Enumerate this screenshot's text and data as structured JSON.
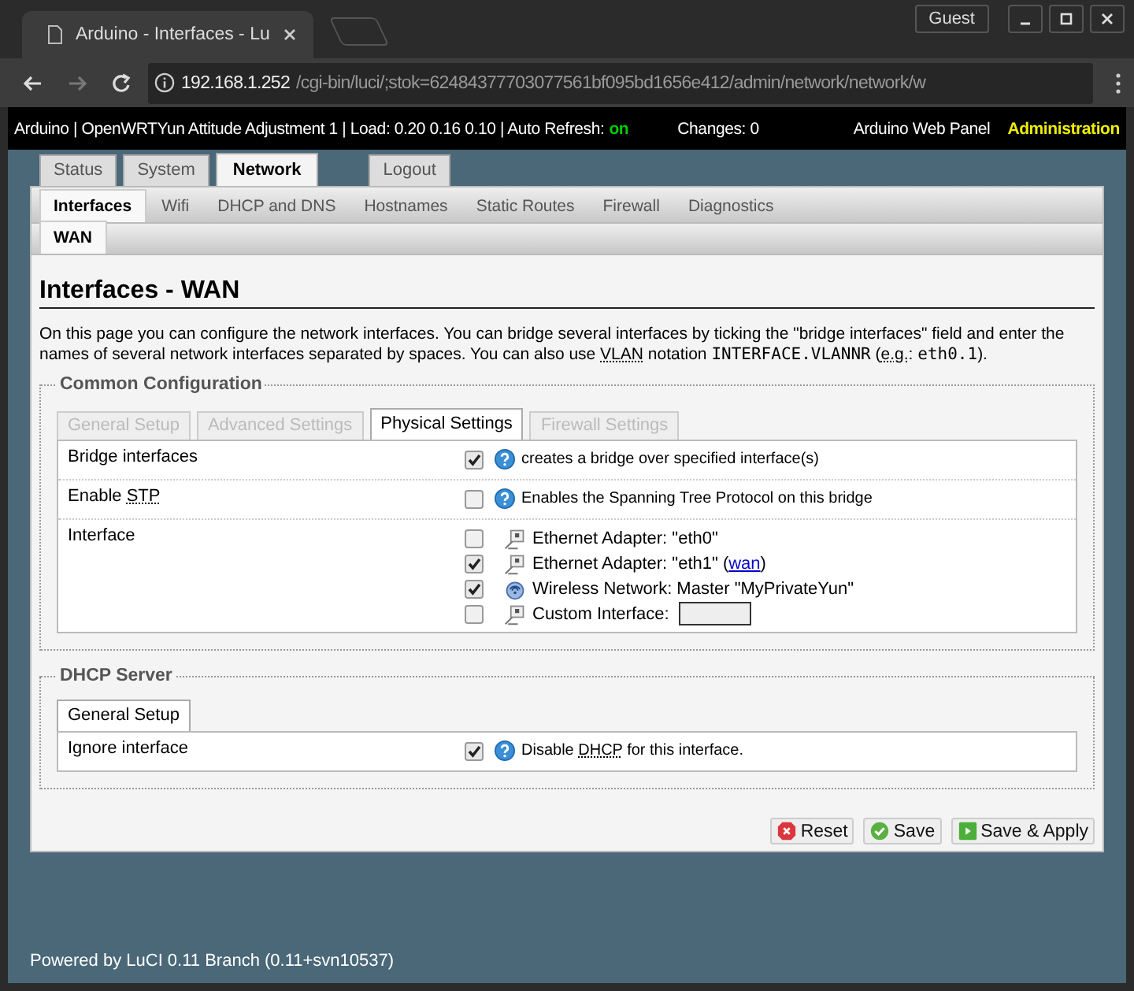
{
  "browser": {
    "tab_title": "Arduino - Interfaces - Lu",
    "user": "Guest",
    "url_host": "192.168.1.252",
    "url_path": "/cgi-bin/luci/;stok=62484377703077561bf095bd1656e412/admin/network/network/w"
  },
  "header": {
    "text": "Arduino | OpenWRTYun Attitude Adjustment 1 | Load: 0.20 0.16 0.10 | Auto Refresh:",
    "refresh": "on",
    "changes": "Changes: 0",
    "panel_link": "Arduino Web Panel",
    "admin_link": "Administration"
  },
  "main_tabs": [
    {
      "label": "Status",
      "selected": false
    },
    {
      "label": "System",
      "selected": false
    },
    {
      "label": "Network",
      "selected": true
    }
  ],
  "logout": "Logout",
  "sub_tabs": [
    {
      "label": "Interfaces",
      "selected": true
    },
    {
      "label": "Wifi",
      "selected": false
    },
    {
      "label": "DHCP and DNS",
      "selected": false
    },
    {
      "label": "Hostnames",
      "selected": false
    },
    {
      "label": "Static Routes",
      "selected": false
    },
    {
      "label": "Firewall",
      "selected": false
    },
    {
      "label": "Diagnostics",
      "selected": false
    }
  ],
  "interface_tabs": [
    {
      "label": "WAN",
      "selected": true
    }
  ],
  "title": "Interfaces - WAN",
  "description": [
    {
      "kind": "text",
      "text": "On this page you can configure the network interfaces. You can bridge several interfaces by ticking the \"bridge interfaces\" field and enter the names of several network interfaces separated by spaces. You can also use "
    },
    {
      "kind": "abbr",
      "text": "VLAN"
    },
    {
      "kind": "text",
      "text": " notation "
    },
    {
      "kind": "code",
      "text": "INTERFACE.VLANNR"
    },
    {
      "kind": "text",
      "text": " ("
    },
    {
      "kind": "abbr",
      "text": "e.g."
    },
    {
      "kind": "text",
      "text": ": "
    },
    {
      "kind": "code",
      "text": "eth0.1"
    },
    {
      "kind": "text",
      "text": ")."
    }
  ],
  "sections": [
    {
      "title": "Common Configuration",
      "tabs": [
        {
          "label": "General Setup",
          "selected": false
        },
        {
          "label": "Advanced Settings",
          "selected": false
        },
        {
          "label": "Physical Settings",
          "selected": true
        },
        {
          "label": "Firewall Settings",
          "selected": false
        }
      ],
      "rows": [
        {
          "kind": "flag",
          "label": [
            {
              "kind": "text",
              "text": "Bridge interfaces"
            }
          ],
          "checked": true,
          "help": [
            {
              "kind": "text",
              "text": "creates a bridge over specified interface(s)"
            }
          ]
        },
        {
          "kind": "flag",
          "label": [
            {
              "kind": "text",
              "text": "Enable "
            },
            {
              "kind": "abbr",
              "text": "STP"
            }
          ],
          "checked": false,
          "help": [
            {
              "kind": "text",
              "text": "Enables the Spanning Tree Protocol on this bridge"
            }
          ]
        },
        {
          "kind": "interfaces",
          "label": [
            {
              "kind": "text",
              "text": "Interface"
            }
          ],
          "options": [
            {
              "checked": false,
              "kind": "ethernet",
              "text": "Ethernet Adapter: \"eth0\""
            },
            {
              "checked": true,
              "kind": "ethernet",
              "text": "Ethernet Adapter: \"eth1\" (",
              "link": "wan",
              "after": ")"
            },
            {
              "checked": true,
              "kind": "wireless",
              "text": "Wireless Network: Master \"MyPrivateYun\""
            },
            {
              "checked": false,
              "kind": "custom",
              "text": "Custom Interface:"
            }
          ]
        }
      ]
    },
    {
      "title": "DHCP Server",
      "tabs": [
        {
          "label": "General Setup",
          "selected": true
        }
      ],
      "rows": [
        {
          "kind": "flag",
          "label": [
            {
              "kind": "text",
              "text": "Ignore interface"
            }
          ],
          "checked": true,
          "help": [
            {
              "kind": "text",
              "text": "Disable "
            },
            {
              "kind": "abbr",
              "text": "DHCP"
            },
            {
              "kind": "text",
              "text": " for this interface."
            }
          ]
        }
      ]
    }
  ],
  "buttons": [
    {
      "kind": "reset",
      "label": "Reset"
    },
    {
      "kind": "save",
      "label": "Save"
    },
    {
      "kind": "apply",
      "label": "Save & Apply"
    }
  ],
  "footer": "Powered by LuCI 0.11 Branch (0.11+svn10537)"
}
